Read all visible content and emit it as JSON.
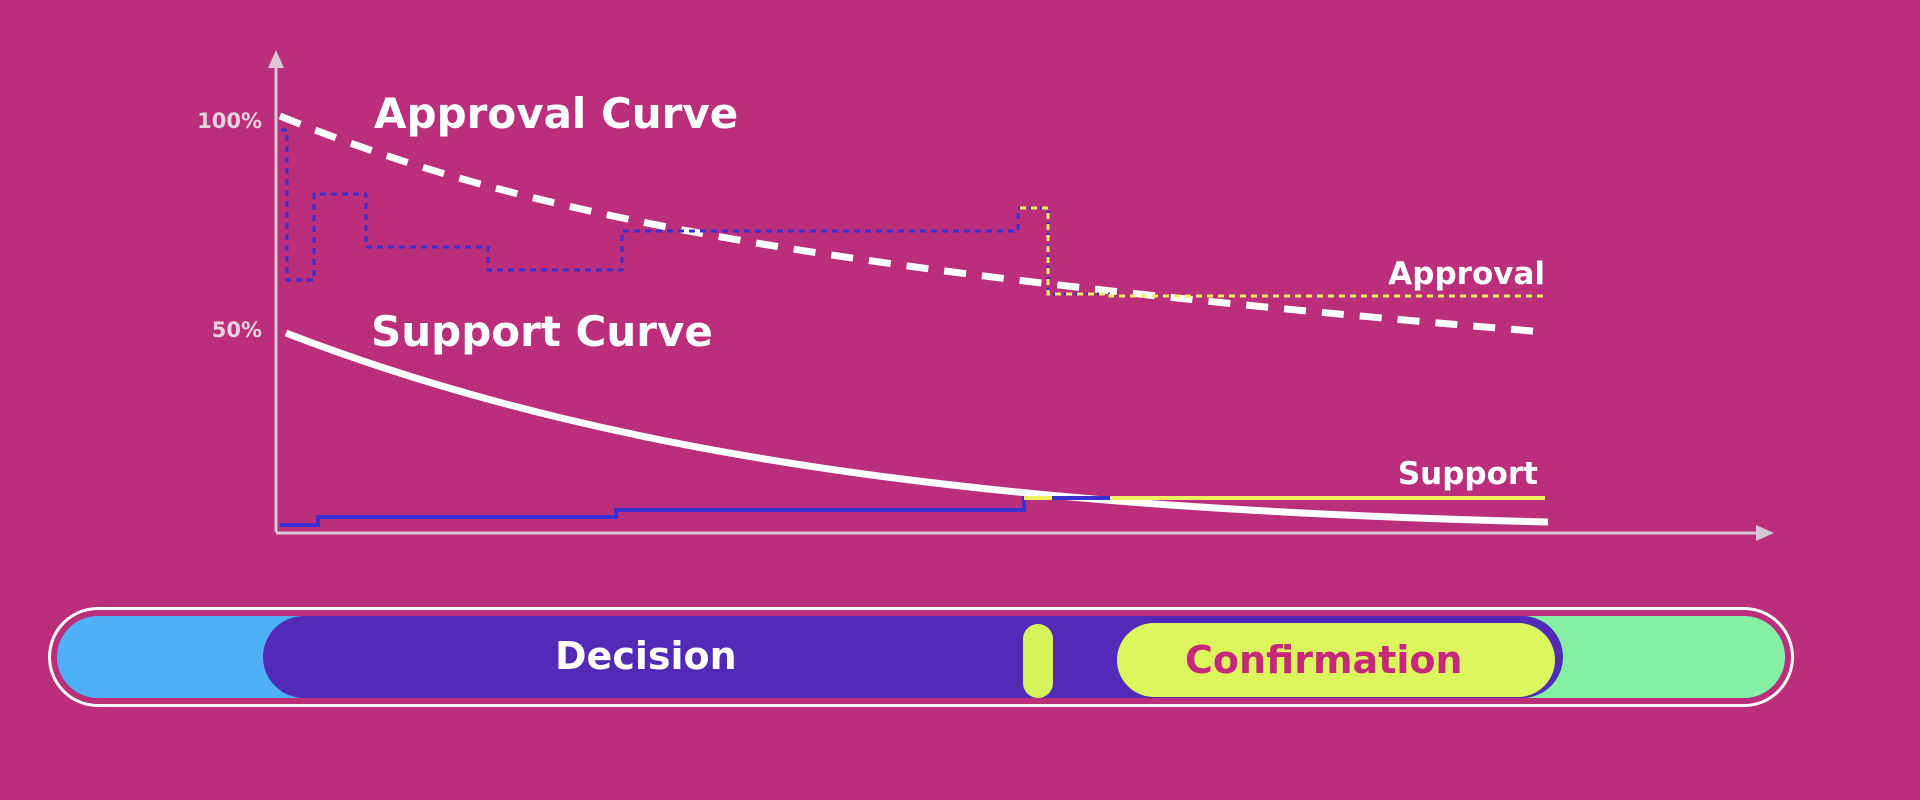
{
  "axis": {
    "y_labels": [
      "100%",
      "50%"
    ],
    "color": "#d9c7d3"
  },
  "curves": {
    "approval_title": "Approval Curve",
    "support_title": "Support Curve",
    "approval_end_label": "Approval",
    "support_end_label": "Support"
  },
  "timeline": {
    "decision_label": "Decision",
    "confirmation_label": "Confirmation"
  },
  "colors": {
    "background": "#bb2e7a",
    "curve": "#ffffff",
    "referendum_line": "#3a2fd0",
    "confirming_line": "#eef060",
    "prepare": "#4fb0f7",
    "decision": "#512bb8",
    "confirmation": "#dcf75d",
    "confirmation_text": "#c8287b",
    "enactment": "#85f0a3"
  }
}
